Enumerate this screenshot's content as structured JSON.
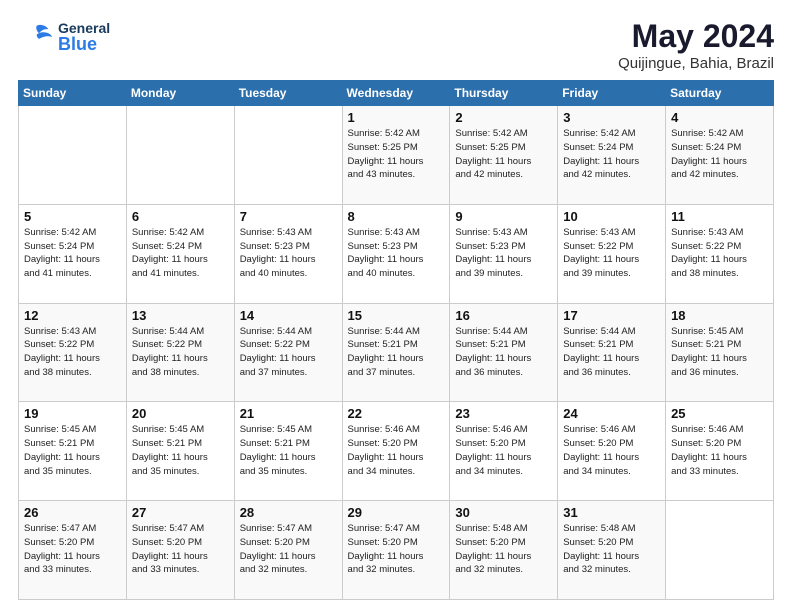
{
  "header": {
    "logo": {
      "general": "General",
      "blue": "Blue",
      "tagline": ""
    },
    "title": "May 2024",
    "subtitle": "Quijingue, Bahia, Brazil"
  },
  "days_of_week": [
    "Sunday",
    "Monday",
    "Tuesday",
    "Wednesday",
    "Thursday",
    "Friday",
    "Saturday"
  ],
  "weeks": [
    {
      "cells": [
        {
          "day": "",
          "info": ""
        },
        {
          "day": "",
          "info": ""
        },
        {
          "day": "",
          "info": ""
        },
        {
          "day": "1",
          "info": "Sunrise: 5:42 AM\nSunset: 5:25 PM\nDaylight: 11 hours\nand 43 minutes."
        },
        {
          "day": "2",
          "info": "Sunrise: 5:42 AM\nSunset: 5:25 PM\nDaylight: 11 hours\nand 42 minutes."
        },
        {
          "day": "3",
          "info": "Sunrise: 5:42 AM\nSunset: 5:24 PM\nDaylight: 11 hours\nand 42 minutes."
        },
        {
          "day": "4",
          "info": "Sunrise: 5:42 AM\nSunset: 5:24 PM\nDaylight: 11 hours\nand 42 minutes."
        }
      ]
    },
    {
      "cells": [
        {
          "day": "5",
          "info": "Sunrise: 5:42 AM\nSunset: 5:24 PM\nDaylight: 11 hours\nand 41 minutes."
        },
        {
          "day": "6",
          "info": "Sunrise: 5:42 AM\nSunset: 5:24 PM\nDaylight: 11 hours\nand 41 minutes."
        },
        {
          "day": "7",
          "info": "Sunrise: 5:43 AM\nSunset: 5:23 PM\nDaylight: 11 hours\nand 40 minutes."
        },
        {
          "day": "8",
          "info": "Sunrise: 5:43 AM\nSunset: 5:23 PM\nDaylight: 11 hours\nand 40 minutes."
        },
        {
          "day": "9",
          "info": "Sunrise: 5:43 AM\nSunset: 5:23 PM\nDaylight: 11 hours\nand 39 minutes."
        },
        {
          "day": "10",
          "info": "Sunrise: 5:43 AM\nSunset: 5:22 PM\nDaylight: 11 hours\nand 39 minutes."
        },
        {
          "day": "11",
          "info": "Sunrise: 5:43 AM\nSunset: 5:22 PM\nDaylight: 11 hours\nand 38 minutes."
        }
      ]
    },
    {
      "cells": [
        {
          "day": "12",
          "info": "Sunrise: 5:43 AM\nSunset: 5:22 PM\nDaylight: 11 hours\nand 38 minutes."
        },
        {
          "day": "13",
          "info": "Sunrise: 5:44 AM\nSunset: 5:22 PM\nDaylight: 11 hours\nand 38 minutes."
        },
        {
          "day": "14",
          "info": "Sunrise: 5:44 AM\nSunset: 5:22 PM\nDaylight: 11 hours\nand 37 minutes."
        },
        {
          "day": "15",
          "info": "Sunrise: 5:44 AM\nSunset: 5:21 PM\nDaylight: 11 hours\nand 37 minutes."
        },
        {
          "day": "16",
          "info": "Sunrise: 5:44 AM\nSunset: 5:21 PM\nDaylight: 11 hours\nand 36 minutes."
        },
        {
          "day": "17",
          "info": "Sunrise: 5:44 AM\nSunset: 5:21 PM\nDaylight: 11 hours\nand 36 minutes."
        },
        {
          "day": "18",
          "info": "Sunrise: 5:45 AM\nSunset: 5:21 PM\nDaylight: 11 hours\nand 36 minutes."
        }
      ]
    },
    {
      "cells": [
        {
          "day": "19",
          "info": "Sunrise: 5:45 AM\nSunset: 5:21 PM\nDaylight: 11 hours\nand 35 minutes."
        },
        {
          "day": "20",
          "info": "Sunrise: 5:45 AM\nSunset: 5:21 PM\nDaylight: 11 hours\nand 35 minutes."
        },
        {
          "day": "21",
          "info": "Sunrise: 5:45 AM\nSunset: 5:21 PM\nDaylight: 11 hours\nand 35 minutes."
        },
        {
          "day": "22",
          "info": "Sunrise: 5:46 AM\nSunset: 5:20 PM\nDaylight: 11 hours\nand 34 minutes."
        },
        {
          "day": "23",
          "info": "Sunrise: 5:46 AM\nSunset: 5:20 PM\nDaylight: 11 hours\nand 34 minutes."
        },
        {
          "day": "24",
          "info": "Sunrise: 5:46 AM\nSunset: 5:20 PM\nDaylight: 11 hours\nand 34 minutes."
        },
        {
          "day": "25",
          "info": "Sunrise: 5:46 AM\nSunset: 5:20 PM\nDaylight: 11 hours\nand 33 minutes."
        }
      ]
    },
    {
      "cells": [
        {
          "day": "26",
          "info": "Sunrise: 5:47 AM\nSunset: 5:20 PM\nDaylight: 11 hours\nand 33 minutes."
        },
        {
          "day": "27",
          "info": "Sunrise: 5:47 AM\nSunset: 5:20 PM\nDaylight: 11 hours\nand 33 minutes."
        },
        {
          "day": "28",
          "info": "Sunrise: 5:47 AM\nSunset: 5:20 PM\nDaylight: 11 hours\nand 32 minutes."
        },
        {
          "day": "29",
          "info": "Sunrise: 5:47 AM\nSunset: 5:20 PM\nDaylight: 11 hours\nand 32 minutes."
        },
        {
          "day": "30",
          "info": "Sunrise: 5:48 AM\nSunset: 5:20 PM\nDaylight: 11 hours\nand 32 minutes."
        },
        {
          "day": "31",
          "info": "Sunrise: 5:48 AM\nSunset: 5:20 PM\nDaylight: 11 hours\nand 32 minutes."
        },
        {
          "day": "",
          "info": ""
        }
      ]
    }
  ]
}
